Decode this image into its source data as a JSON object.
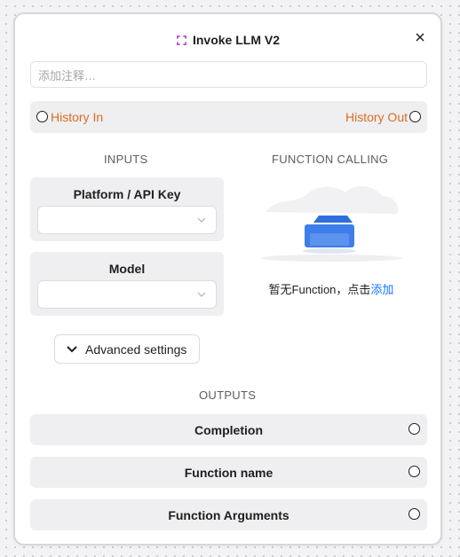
{
  "node": {
    "title": "Invoke LLM V2",
    "note_placeholder": "添加注释…",
    "history": {
      "in_label": "History In",
      "out_label": "History Out"
    },
    "inputs": {
      "section_title": "INPUTS",
      "fields": [
        {
          "label": "Platform / API Key",
          "value": ""
        },
        {
          "label": "Model",
          "value": ""
        }
      ],
      "advanced_label": "Advanced settings"
    },
    "function_calling": {
      "section_title": "FUNCTION CALLING",
      "empty_text": "暂无Function，点击",
      "add_link": "添加"
    },
    "outputs": {
      "section_title": "OUTPUTS",
      "items": [
        {
          "label": "Completion"
        },
        {
          "label": "Function name"
        },
        {
          "label": "Function Arguments"
        }
      ]
    }
  },
  "colors": {
    "accent_orange": "#dd6b20",
    "link_blue": "#1677ff",
    "node_icon": "#b237c4",
    "tray_blue": "#3f7ee8"
  },
  "icons": [
    "node-icon",
    "close-icon",
    "chevron-down-icon",
    "empty-tray-icon"
  ]
}
